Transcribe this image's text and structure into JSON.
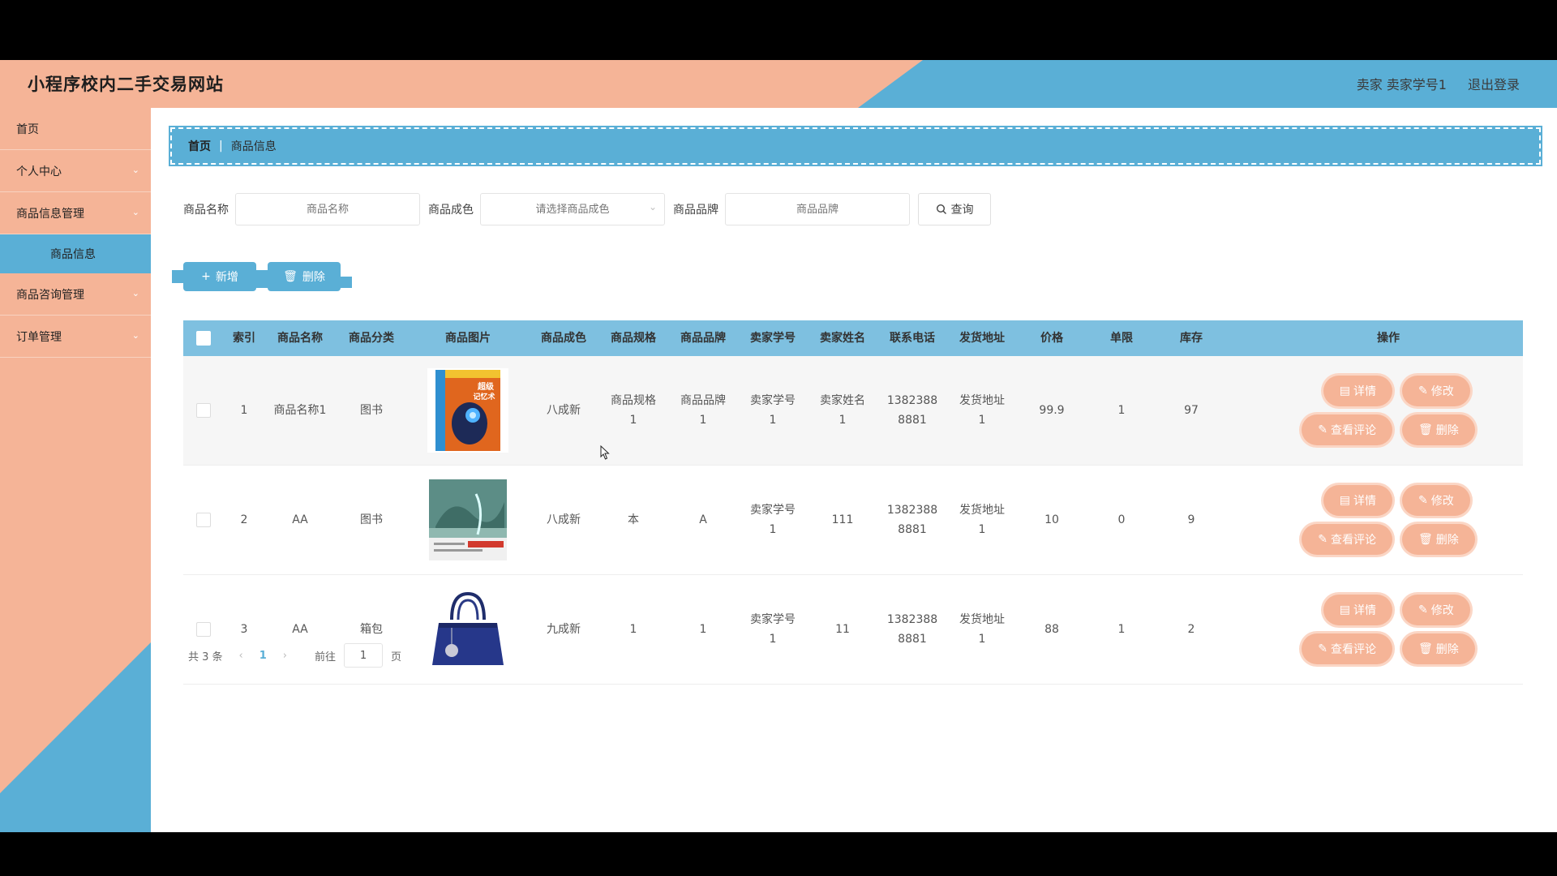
{
  "header": {
    "title": "小程序校内二手交易网站",
    "user": "卖家 卖家学号1",
    "logout": "退出登录"
  },
  "sidebar": {
    "items": [
      {
        "label": "首页"
      },
      {
        "label": "个人中心"
      },
      {
        "label": "商品信息管理"
      },
      {
        "label": "商品信息"
      },
      {
        "label": "商品咨询管理"
      },
      {
        "label": "订单管理"
      }
    ]
  },
  "breadcrumb": {
    "home": "首页",
    "current": "商品信息"
  },
  "search": {
    "name_label": "商品名称",
    "name_placeholder": "商品名称",
    "condition_label": "商品成色",
    "condition_placeholder": "请选择商品成色",
    "brand_label": "商品品牌",
    "brand_placeholder": "商品品牌",
    "button": "查询"
  },
  "actions": {
    "add": "新增",
    "delete": "删除"
  },
  "table": {
    "headers": [
      "索引",
      "商品名称",
      "商品分类",
      "商品图片",
      "商品成色",
      "商品规格",
      "商品品牌",
      "卖家学号",
      "卖家姓名",
      "联系电话",
      "发货地址",
      "价格",
      "单限",
      "库存",
      "操作"
    ],
    "rows": [
      {
        "idx": "1",
        "name": "商品名称1",
        "cat": "图书",
        "condition": "八成新",
        "spec": [
          "商品规格",
          "1"
        ],
        "brand": [
          "商品品牌",
          "1"
        ],
        "seller_no": [
          "卖家学号",
          "1"
        ],
        "seller_name": [
          "卖家姓名",
          "1"
        ],
        "tel": [
          "1382388",
          "8881"
        ],
        "addr": [
          "发货地址",
          "1"
        ],
        "price": "99.9",
        "limit": "1",
        "stock": "97"
      },
      {
        "idx": "2",
        "name": "AA",
        "cat": "图书",
        "condition": "八成新",
        "spec": [
          "本",
          ""
        ],
        "brand": [
          "A",
          ""
        ],
        "seller_no": [
          "卖家学号",
          "1"
        ],
        "seller_name": [
          "111",
          ""
        ],
        "tel": [
          "1382388",
          "8881"
        ],
        "addr": [
          "发货地址",
          "1"
        ],
        "price": "10",
        "limit": "0",
        "stock": "9"
      },
      {
        "idx": "3",
        "name": "AA",
        "cat": "箱包",
        "condition": "九成新",
        "spec": [
          "1",
          ""
        ],
        "brand": [
          "1",
          ""
        ],
        "seller_no": [
          "卖家学号",
          "1"
        ],
        "seller_name": [
          "11",
          ""
        ],
        "tel": [
          "1382388",
          "8881"
        ],
        "addr": [
          "发货地址",
          "1"
        ],
        "price": "88",
        "limit": "1",
        "stock": "2"
      }
    ],
    "ops": {
      "detail": "详情",
      "edit": "修改",
      "comments": "查看评论",
      "delete": "删除"
    }
  },
  "book1_cover": {
    "line1": "超级",
    "line2": "记忆术"
  },
  "pager": {
    "total": "共 3 条",
    "page": "1",
    "goto": "前往",
    "goto_value": "1",
    "unit": "页"
  },
  "colors": {
    "salmon": "#f5b497",
    "blue": "#5aafd6",
    "header_blue": "#7ec0e0"
  }
}
